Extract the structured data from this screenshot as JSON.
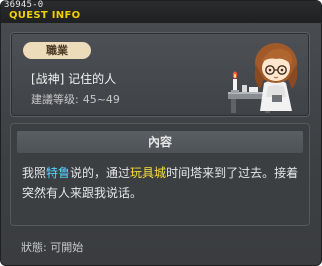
{
  "window": {
    "quest_id": "36945-0",
    "title": "QUEST INFO"
  },
  "quest": {
    "job_badge": "職業",
    "name": "[战神] 记住的人",
    "level_label": "建議等级:",
    "level_range": "45~49",
    "npc_icon": "npc-portrait"
  },
  "content": {
    "header": "內容",
    "text_parts": {
      "p1": "我照",
      "npc": "特鲁",
      "p2": "说的，通过",
      "map": "玩具城",
      "p3": "时间塔来到了过去。接着突然有人来跟我说话。"
    }
  },
  "status": {
    "label": "狀態:",
    "value": "可開始"
  },
  "colors": {
    "title": "#f0d000",
    "npc_highlight": "#56d6ff",
    "map_highlight": "#f7e03a"
  }
}
